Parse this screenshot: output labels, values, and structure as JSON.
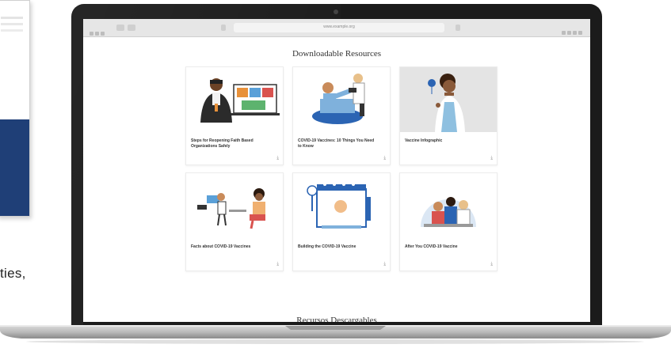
{
  "side_text": "ties,",
  "browser": {
    "url": "www.example.org"
  },
  "page": {
    "heading": "Downloadable Resources",
    "heading_es": "Recursos Descargables",
    "cards": [
      {
        "title": "Steps for Reopening Faith Based Organizations Safely",
        "art": "presenter-video-call"
      },
      {
        "title": "COVID-19 Vaccines: 10 Things You Need to Know",
        "art": "doctor-patient-vaccine"
      },
      {
        "title": "Vaccine Infographic",
        "art": "doctor-portrait"
      },
      {
        "title": "Facts about COVID-19 Vaccines",
        "art": "people-talking"
      },
      {
        "title": "Building the COVID-19 Vaccine",
        "art": "calendar-vaccine"
      },
      {
        "title": "After You COVID-19 Vaccine",
        "art": "lab-scientists"
      }
    ],
    "download_icon": "download-icon"
  },
  "colors": {
    "document_band": "#1f3f77",
    "laptop_body": "#1b1b1b",
    "accent_blue": "#2b64b3",
    "accent_orange": "#e8913a"
  }
}
